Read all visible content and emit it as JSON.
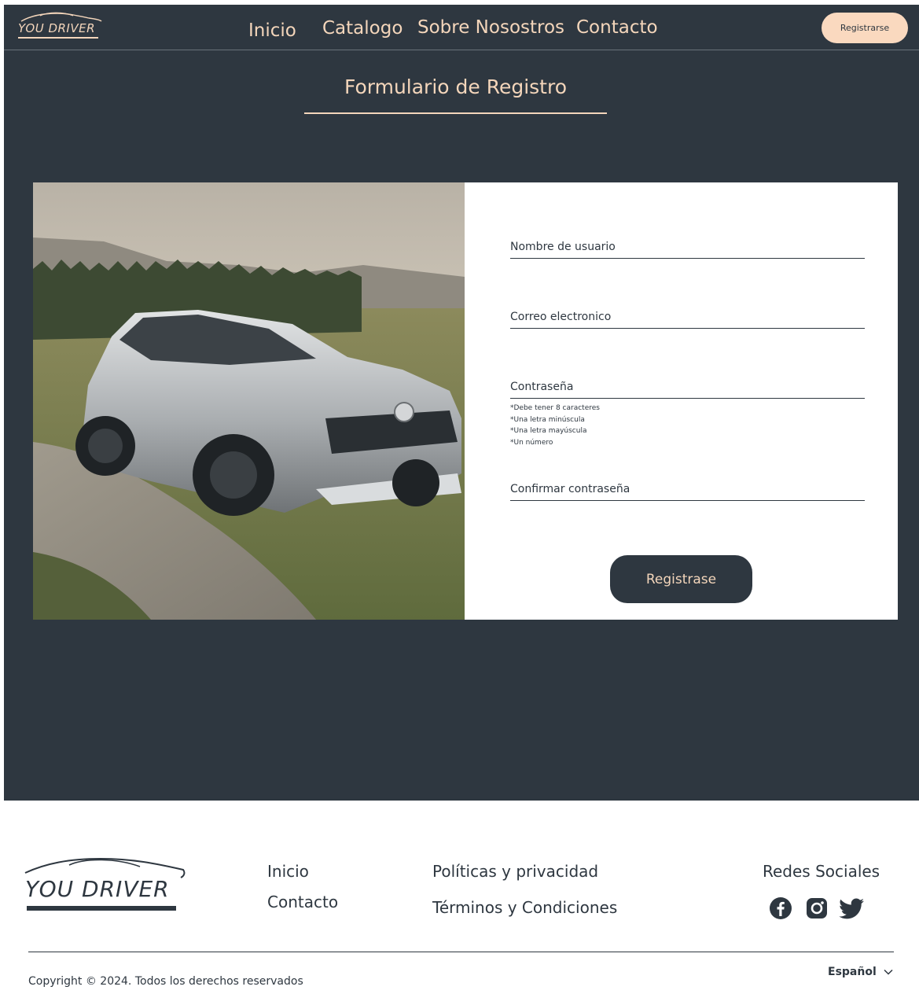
{
  "brand": {
    "name": "YOU DRIVER"
  },
  "nav": {
    "items": [
      "Inicio",
      "Catalogo",
      "Sobre Nosostros",
      "Contacto"
    ],
    "register_label": "Registrarse"
  },
  "page": {
    "title": "Formulario de Registro"
  },
  "form": {
    "fields": [
      {
        "label": "Nombre de usuario"
      },
      {
        "label": "Correo electronico"
      },
      {
        "label": "Contraseña"
      },
      {
        "label": "Confirmar contraseña"
      }
    ],
    "password_hints": [
      "*Debe tener 8 caracteres",
      "*Una letra minúscula",
      "*Una letra mayúscula",
      "*Un número"
    ],
    "submit_label": "Registrase"
  },
  "footer": {
    "links_col1": [
      "Inicio",
      "Contacto"
    ],
    "links_col2": [
      "Políticas y privacidad",
      "Términos y Condiciones"
    ],
    "social_title": "Redes Sociales",
    "social_icons": [
      "facebook-icon",
      "instagram-icon",
      "twitter-icon"
    ],
    "copyright": "Copyright © 2024. Todos los derechos reservados",
    "language": "Español"
  },
  "colors": {
    "dark": "#2e3740",
    "accent": "#f4d6bb",
    "button_peach": "#fad9bf"
  }
}
